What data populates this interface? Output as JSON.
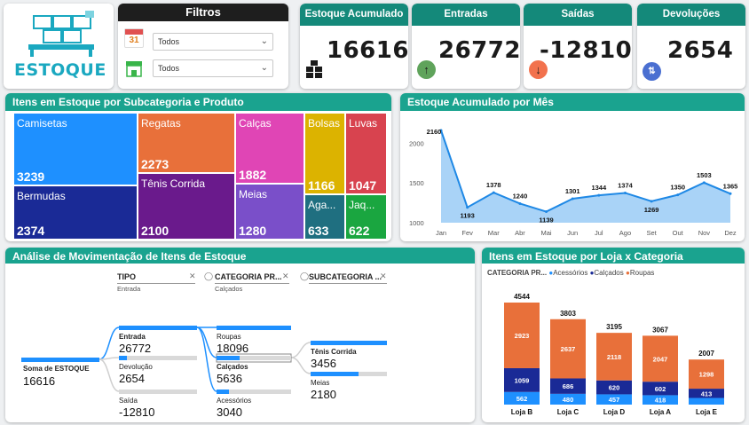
{
  "logo": {
    "text": "ESTOQUE"
  },
  "filters": {
    "title": "Filtros",
    "date_value": "Todos",
    "store_value": "Todos",
    "calendar_number": "31"
  },
  "kpis": {
    "acumulado": {
      "title": "Estoque Acumulado",
      "value": "16616"
    },
    "entradas": {
      "title": "Entradas",
      "value": "26772"
    },
    "saidas": {
      "title": "Saídas",
      "value": "-12810"
    },
    "devolucoes": {
      "title": "Devoluções",
      "value": "2654"
    }
  },
  "treemap": {
    "title": "Itens em Estoque por Subcategoria e Produto",
    "cells": [
      {
        "name": "Camisetas",
        "value": "3239",
        "color": "#1e90ff"
      },
      {
        "name": "Bermudas",
        "value": "2374",
        "color": "#1a2a96"
      },
      {
        "name": "Regatas",
        "value": "2273",
        "color": "#e8703a"
      },
      {
        "name": "Tênis Corrida",
        "value": "2100",
        "color": "#6a1a8c"
      },
      {
        "name": "Calças",
        "value": "1882",
        "color": "#e045b5"
      },
      {
        "name": "Meias",
        "value": "1280",
        "color": "#7a4fc9"
      },
      {
        "name": "Bolsas",
        "value": "1166",
        "color": "#dcb300"
      },
      {
        "name": "Luvas",
        "value": "1047",
        "color": "#d8434f"
      },
      {
        "name": "Aga...",
        "value": "633",
        "color": "#1f6f80"
      },
      {
        "name": "Jaq...",
        "value": "622",
        "color": "#1aa640"
      }
    ]
  },
  "line_chart_title": "Estoque Acumulado por Mês",
  "chart_data": {
    "type": "area",
    "title": "Estoque Acumulado por Mês",
    "categories": [
      "Jan",
      "Fev",
      "Mar",
      "Abr",
      "Mai",
      "Jun",
      "Jul",
      "Ago",
      "Set",
      "Out",
      "Nov",
      "Dez"
    ],
    "values": [
      2160,
      1193,
      1378,
      1240,
      1139,
      1301,
      1344,
      1374,
      1269,
      1350,
      1503,
      1365
    ],
    "ylim": [
      1000,
      2160
    ],
    "yticks": [
      1000,
      1500,
      2000
    ],
    "color": "#1e88e5",
    "fill": "#a9d3f7"
  },
  "decomp": {
    "title": "Análise de Movimentação de Itens de Estoque",
    "headers": [
      {
        "label": "TIPO",
        "sub": "Entrada"
      },
      {
        "label": "CATEGORIA PR...",
        "sub": "Calçados"
      },
      {
        "label": "SUBCATEGORIA ...",
        "sub": ""
      }
    ],
    "root": {
      "label": "Soma de ESTOQUE",
      "value": "16616"
    },
    "tipo": [
      {
        "label": "Entrada",
        "value": "26772",
        "fill": 1.0,
        "bold": true
      },
      {
        "label": "Devolução",
        "value": "2654",
        "fill": 0.1
      },
      {
        "label": "Saída",
        "value": "-12810",
        "fill": 0.0
      }
    ],
    "categoria": [
      {
        "label": "Roupas",
        "value": "18096",
        "fill": 1.0
      },
      {
        "label": "Calçados",
        "value": "5636",
        "fill": 0.31,
        "bold": true
      },
      {
        "label": "Acessórios",
        "value": "3040",
        "fill": 0.17
      }
    ],
    "subcategoria": [
      {
        "label": "Tênis Corrida",
        "value": "3456",
        "fill": 1.0,
        "bold": true
      },
      {
        "label": "Meias",
        "value": "2180",
        "fill": 0.63
      }
    ]
  },
  "stacked": {
    "title": "Itens em Estoque por Loja x Categoria",
    "legend_title": "CATEGORIA PR...",
    "series": [
      {
        "name": "Acessórios",
        "color": "#1e90ff"
      },
      {
        "name": "Calçados",
        "color": "#1a2a96"
      },
      {
        "name": "Roupas",
        "color": "#e8703a"
      }
    ],
    "stores": [
      {
        "name": "Loja B",
        "total": "4544",
        "acessorios": 562,
        "calcados": 1059,
        "roupas": 2923
      },
      {
        "name": "Loja C",
        "total": "3803",
        "acessorios": 480,
        "calcados": 686,
        "roupas": 2637
      },
      {
        "name": "Loja D",
        "total": "3195",
        "acessorios": 457,
        "calcados": 620,
        "roupas": 2118
      },
      {
        "name": "Loja A",
        "total": "3067",
        "acessorios": 418,
        "calcados": 602,
        "roupas": 2047
      },
      {
        "name": "Loja E",
        "total": "2007",
        "acessorios": 296,
        "calcados": 413,
        "roupas": 1298
      }
    ]
  }
}
